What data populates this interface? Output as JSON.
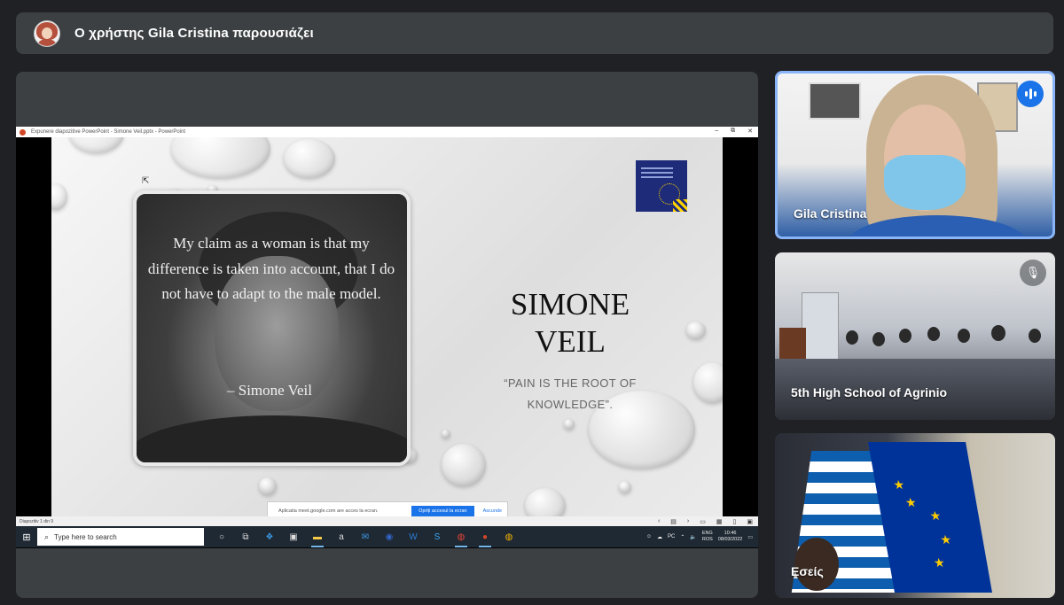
{
  "header": {
    "presenting_text": "Ο χρήστης Gila Cristina παρουσιάζει"
  },
  "presentation": {
    "window_title": "Expunere diapozitive PowerPoint - Simone Veil.pptx - PowerPoint",
    "window_controls": [
      "–",
      "⧉",
      "✕"
    ],
    "slide": {
      "quote": "My claim as a woman is that my difference is taken into account, that I do not have to adapt to the male model.",
      "quote_author": "– Simone Veil",
      "title_line1": "SIMONE",
      "title_line2": "VEIL",
      "subtitle": "“PAIN IS THE ROOT OF KNOWLEDGE”."
    },
    "notification": {
      "text": "Aplicatia meet.google.com are acces la ecran.",
      "primary": "Opriți accesul la ecran",
      "secondary": "Ascunde"
    },
    "status_bar": {
      "slide_counter": "Diapozitiv 1 din 9"
    }
  },
  "taskbar": {
    "search_placeholder": "Type here to search",
    "tray_label": "PC",
    "language_top": "ENG",
    "language_bottom": "ROS",
    "time": "10:46",
    "date": "08/03/2022"
  },
  "participants": [
    {
      "name": "Gila Cristina",
      "status": "speaking"
    },
    {
      "name": "5th High School of Agrinio",
      "status": "muted"
    },
    {
      "name": "Εσείς",
      "status": "none"
    }
  ],
  "colors": {
    "meet_background": "#202124",
    "panel": "#3c4043",
    "active_speaker_border": "#8ab4f8",
    "speaking_badge": "#1a73e8"
  }
}
